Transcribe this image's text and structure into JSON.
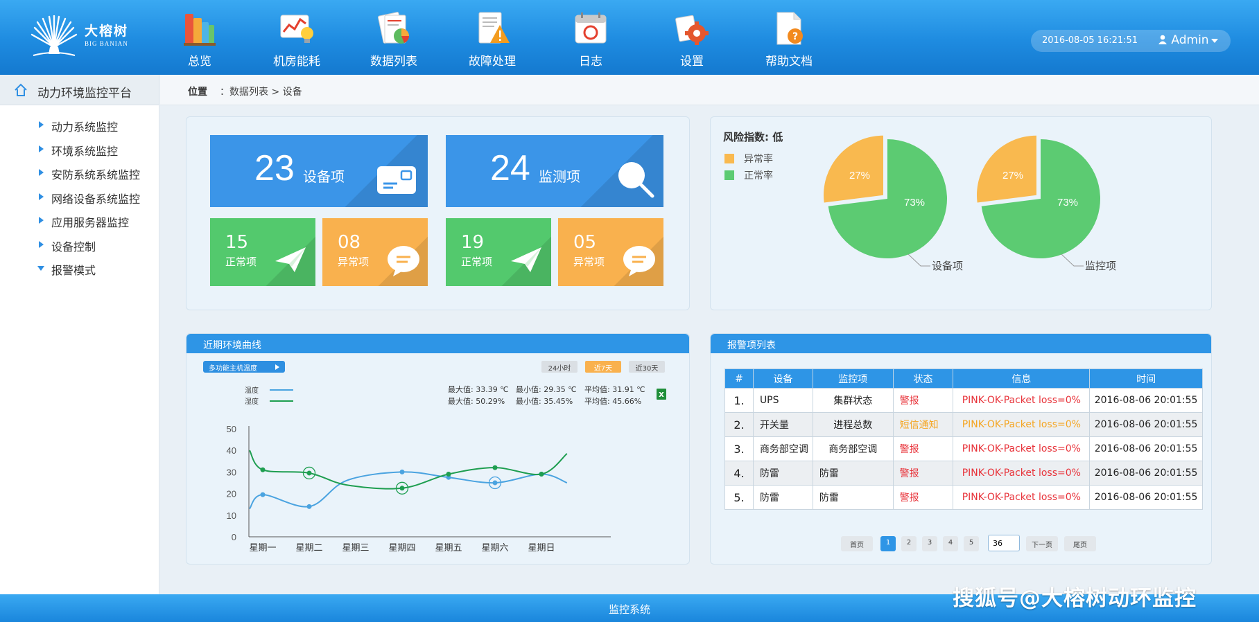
{
  "brand": {
    "name": "大榕树",
    "sub": "BIG BANIAN"
  },
  "nav": [
    {
      "label": "总览",
      "icon": "books-icon"
    },
    {
      "label": "机房能耗",
      "icon": "energy-chart-icon"
    },
    {
      "label": "数据列表",
      "icon": "data-report-icon"
    },
    {
      "label": "故障处理",
      "icon": "warning-note-icon"
    },
    {
      "label": "日志",
      "icon": "calendar-icon"
    },
    {
      "label": "设置",
      "icon": "settings-gear-icon"
    },
    {
      "label": "帮助文档",
      "icon": "help-document-icon"
    }
  ],
  "header": {
    "datetime": "2016-08-05 16:21:51",
    "user": "Admin"
  },
  "sidebar": {
    "title": "动力环境监控平台",
    "items": [
      {
        "label": "动力系统监控"
      },
      {
        "label": "环境系统监控"
      },
      {
        "label": "安防系统系统监控"
      },
      {
        "label": "网络设备系统监控"
      },
      {
        "label": "应用服务器监控"
      },
      {
        "label": "设备控制"
      },
      {
        "label": "报警模式"
      }
    ]
  },
  "breadcrumb": {
    "key": "位置",
    "path": "：数据列表 > 设备"
  },
  "summary": {
    "devices": {
      "count": "23",
      "label": "设备项",
      "normal": "15",
      "normal_label": "正常项",
      "abnormal": "08",
      "abnormal_label": "异常项"
    },
    "monitors": {
      "count": "24",
      "label": "监测项",
      "normal": "19",
      "normal_label": "正常项",
      "abnormal": "05",
      "abnormal_label": "异常项"
    }
  },
  "risk": {
    "title": "风险指数: 低",
    "legend": {
      "abnormal": "异常率",
      "normal": "正常率"
    },
    "pies": [
      {
        "name": "设备项",
        "abnormal": 27,
        "normal": 73,
        "abnormal_label": "27%",
        "normal_label": "73%"
      },
      {
        "name": "监控项",
        "abnormal": 27,
        "normal": 73,
        "abnormal_label": "27%",
        "normal_label": "73%"
      }
    ],
    "colors": {
      "abnormal": "#f9b94f",
      "normal": "#5ccb72"
    }
  },
  "curve": {
    "title": "近期环境曲线",
    "sensor": "多功能主机温度",
    "ranges": [
      "24小时",
      "近7天",
      "近30天"
    ],
    "active_range": 1,
    "legend": [
      "温度",
      "湿度"
    ],
    "stats": {
      "temp": {
        "max": "最大值: 33.39 ℃",
        "min": "最小值: 29.35 ℃",
        "avg": "平均值: 31.91 ℃"
      },
      "hum": {
        "max": "最大值: 50.29%",
        "min": "最小值: 35.45%",
        "avg": "平均值: 45.66%"
      }
    }
  },
  "chart_data": {
    "type": "line",
    "categories": [
      "星期一",
      "星期二",
      "星期三",
      "星期四",
      "星期五",
      "星期六",
      "星期日"
    ],
    "ylim": [
      0,
      50
    ],
    "yticks": [
      "0",
      "10",
      "20",
      "30",
      "40",
      "50"
    ],
    "series": [
      {
        "name": "温度",
        "color": "#4aa3e0",
        "x": [
          -0.35,
          0,
          1,
          1.8,
          3,
          4,
          5,
          6,
          6.55
        ],
        "values": [
          13,
          19.5,
          14,
          26,
          30,
          27.5,
          25,
          29,
          25
        ]
      },
      {
        "name": "湿度",
        "color": "#1e9e50",
        "x": [
          -0.35,
          0,
          1,
          1.8,
          3,
          4,
          5,
          6,
          6.55
        ],
        "values": [
          40,
          31,
          29.5,
          24,
          22.5,
          29,
          32,
          29,
          38.5
        ]
      }
    ],
    "highlights": [
      {
        "series": 1,
        "index": 2
      },
      {
        "series": 1,
        "index": 4
      },
      {
        "series": 0,
        "index": 6
      }
    ]
  },
  "alarms": {
    "title": "报警项列表",
    "headers": [
      "#",
      "设备",
      "监控项",
      "状态",
      "信息",
      "时间"
    ],
    "rows": [
      {
        "no": "1.",
        "device": "UPS",
        "item": "集群状态",
        "status": "警报",
        "info": "PINK-OK-Packet loss=0%",
        "time": "2016-08-06 20:01:55"
      },
      {
        "no": "2.",
        "device": "开关量",
        "item": "进程总数",
        "status": "短信通知",
        "info": "PINK-OK-Packet loss=0%",
        "time": "2016-08-06 20:01:55"
      },
      {
        "no": "3.",
        "device": "商务部空调",
        "item": "商务部空调",
        "status": "警报",
        "info": "PINK-OK-Packet loss=0%",
        "time": "2016-08-06 20:01:55"
      },
      {
        "no": "4.",
        "device": "防雷",
        "item": "防雷",
        "status": "警报",
        "info": "PINK-OK-Packet loss=0%",
        "time": "2016-08-06 20:01:55"
      },
      {
        "no": "5.",
        "device": "防雷",
        "item": "防雷",
        "status": "警报",
        "info": "PINK-OK-Packet loss=0%",
        "time": "2016-08-06 20:01:55"
      }
    ],
    "pager": {
      "first": "首页",
      "pages": [
        "1",
        "2",
        "3",
        "4",
        "5"
      ],
      "current": "1",
      "input_value": "36",
      "next": "下一页",
      "last": "尾页"
    }
  },
  "footer": {
    "text": "监控系统"
  },
  "watermark": "搜狐号@大榕树动环监控"
}
